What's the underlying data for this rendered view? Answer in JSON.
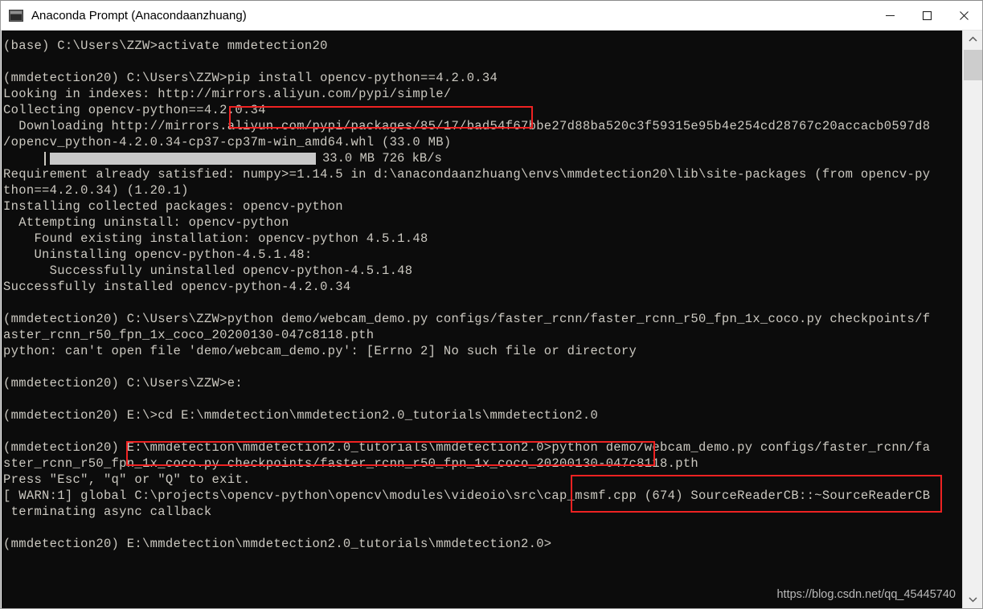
{
  "window": {
    "title": "Anaconda Prompt (Anacondaanzhuang)",
    "icon": "console-window-icon",
    "minimize_label": "–",
    "maximize_label": "□",
    "close_label": "✕"
  },
  "theme": {
    "console_bg": "#0c0c0c",
    "console_fg": "#ccc9c1",
    "titlebar_bg": "#ffffff",
    "annotation_red": "#ee2222",
    "watermark_color": "#b9b9b9",
    "progress_fill": "#c8c8c8"
  },
  "console": {
    "lines": [
      "(base) C:\\Users\\ZZW>activate mmdetection20",
      "",
      "(mmdetection20) C:\\Users\\ZZW>pip install opencv-python==4.2.0.34",
      "Looking in indexes: http://mirrors.aliyun.com/pypi/simple/",
      "Collecting opencv-python==4.2.0.34",
      "  Downloading http://mirrors.aliyun.com/pypi/packages/85/17/bad54f67bbe27d88ba520c3f59315e95b4e254cd28767c20accacb0597d8",
      "/opencv_python-4.2.0.34-cp37-cp37m-win_amd64.whl (33.0 MB)",
      "__PROGRESS__",
      "Requirement already satisfied: numpy>=1.14.5 in d:\\anacondaanzhuang\\envs\\mmdetection20\\lib\\site-packages (from opencv-py",
      "thon==4.2.0.34) (1.20.1)",
      "Installing collected packages: opencv-python",
      "  Attempting uninstall: opencv-python",
      "    Found existing installation: opencv-python 4.5.1.48",
      "    Uninstalling opencv-python-4.5.1.48:",
      "      Successfully uninstalled opencv-python-4.5.1.48",
      "Successfully installed opencv-python-4.2.0.34",
      "",
      "(mmdetection20) C:\\Users\\ZZW>python demo/webcam_demo.py configs/faster_rcnn/faster_rcnn_r50_fpn_1x_coco.py checkpoints/f",
      "aster_rcnn_r50_fpn_1x_coco_20200130-047c8118.pth",
      "python: can't open file 'demo/webcam_demo.py': [Errno 2] No such file or directory",
      "",
      "(mmdetection20) C:\\Users\\ZZW>e:",
      "",
      "(mmdetection20) E:\\>cd E:\\mmdetection\\mmdetection2.0_tutorials\\mmdetection2.0",
      "",
      "(mmdetection20) E:\\mmdetection\\mmdetection2.0_tutorials\\mmdetection2.0>python demo/webcam_demo.py configs/faster_rcnn/fa",
      "ster_rcnn_r50_fpn_1x_coco.py checkpoints/faster_rcnn_r50_fpn_1x_coco_20200130-047c8118.pth",
      "Press \"Esc\", \"q\" or \"Q\" to exit.",
      "[ WARN:1] global C:\\projects\\opencv-python\\opencv\\modules\\videoio\\src\\cap_msmf.cpp (674) SourceReaderCB::~SourceReaderCB",
      " terminating async callback",
      "",
      "(mmdetection20) E:\\mmdetection\\mmdetection2.0_tutorials\\mmdetection2.0>"
    ],
    "progress": {
      "filled_text": "",
      "status": "33.0 MB 726 kB/s"
    }
  },
  "annotations": [
    {
      "id": "redbox-pip",
      "target": "pip install opencv-python==4.2.0.34"
    },
    {
      "id": "redbox-cd",
      "target": "E:\\>cd E:\\mmdetection\\mmdetection2.0_tutorials\\mmdetection2.0"
    },
    {
      "id": "redbox-webcam",
      "target": "python demo/webcam_demo.py configs/faster_rcnn/faster_rcnn_r50_fpn_1x_coco.py checkpoints/faster_rcnn_r50_fpn_1x_coco_20200130-047c8118.pth"
    }
  ],
  "watermark": {
    "text": "https://blog.csdn.net/qq_45445740"
  },
  "scrollbar": {
    "up_arrow": "⌃",
    "down_arrow": "⌄"
  }
}
